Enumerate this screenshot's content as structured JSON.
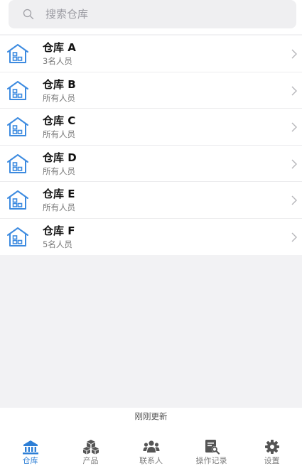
{
  "search": {
    "placeholder": "搜索仓库"
  },
  "warehouses": [
    {
      "name": "仓库 A",
      "members": "3名人员"
    },
    {
      "name": "仓库 B",
      "members": "所有人员"
    },
    {
      "name": "仓库 C",
      "members": "所有人员"
    },
    {
      "name": "仓库 D",
      "members": "所有人员"
    },
    {
      "name": "仓库 E",
      "members": "所有人员"
    },
    {
      "name": "仓库 F",
      "members": "5名人员"
    }
  ],
  "status_text": "刚刚更新",
  "tabs": [
    {
      "label": "仓库",
      "icon": "bank-icon",
      "active": true
    },
    {
      "label": "产品",
      "icon": "boxes-icon",
      "active": false
    },
    {
      "label": "联系人",
      "icon": "people-icon",
      "active": false
    },
    {
      "label": "操作记录",
      "icon": "log-search-icon",
      "active": false
    },
    {
      "label": "设置",
      "icon": "gear-icon",
      "active": false
    }
  ],
  "colors": {
    "accent": "#2e7fd6",
    "icon_gray": "#555555",
    "background": "#f2f2f4"
  }
}
